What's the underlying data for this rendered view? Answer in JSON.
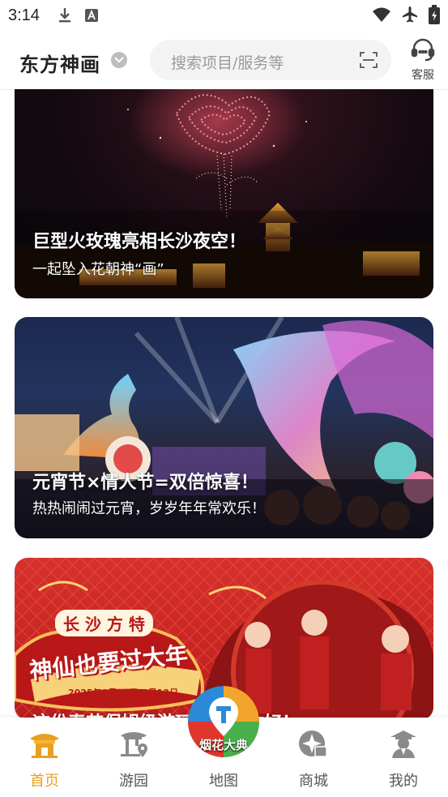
{
  "status_bar": {
    "time": "3:14"
  },
  "header": {
    "brand": "东方神画",
    "search_placeholder": "搜索项目/服务等",
    "customer_service_label": "客服"
  },
  "cards": [
    {
      "title": "巨型火玫瑰亮相长沙夜空！",
      "subtitle": "一起坠入花朝神“画”"
    },
    {
      "title": "元宵节×情人节=双倍惊喜！",
      "subtitle": "热热闹闹过元宵，岁岁年年常欢乐！"
    },
    {
      "title": "这份春节保姆级游玩攻略请收好！",
      "subtitle": "",
      "poster_line1": "长 沙 方 特",
      "poster_line2": "神仙也要过大年",
      "poster_date": "2025年1月29日-2月12日",
      "map_fab_text": "烟花大典"
    }
  ],
  "tabs": [
    {
      "label": "首页",
      "icon": "home-pavilion-icon",
      "active": true
    },
    {
      "label": "游园",
      "icon": "park-map-pin-icon",
      "active": false
    },
    {
      "label": "地图",
      "icon": "map-icon",
      "active": false
    },
    {
      "label": "商城",
      "icon": "mall-sparkle-icon",
      "active": false
    },
    {
      "label": "我的",
      "icon": "profile-icon",
      "active": false
    }
  ],
  "colors": {
    "accent": "#e8a020",
    "tab_inactive": "#555555",
    "search_bg": "#f3f3f3"
  }
}
